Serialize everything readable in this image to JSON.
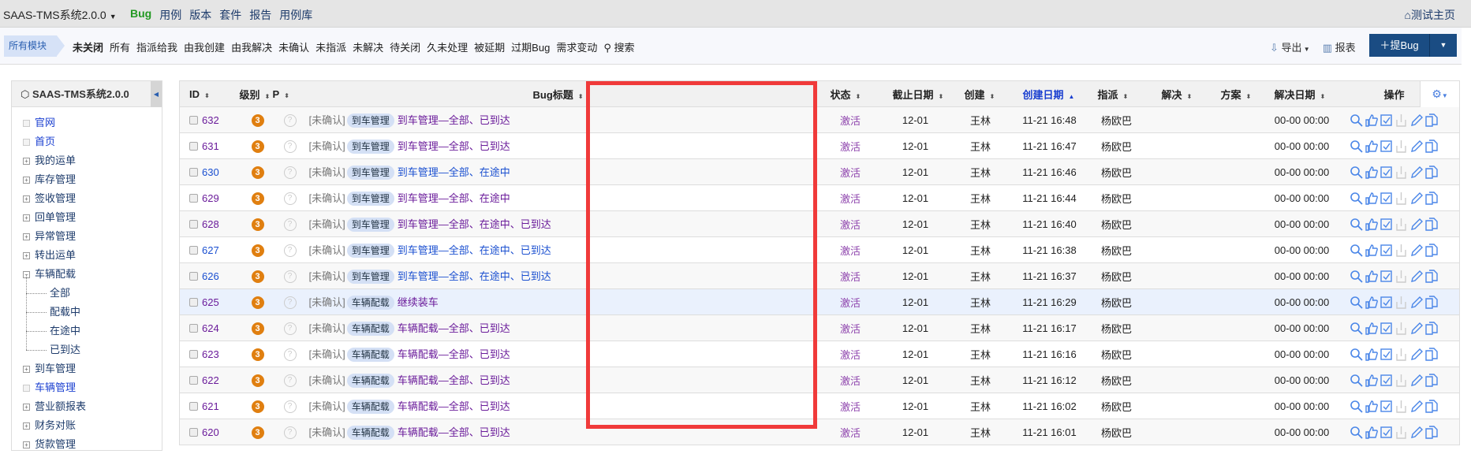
{
  "topbar": {
    "product": "SAAS-TMS系统2.0.0",
    "nav": [
      "Bug",
      "用例",
      "版本",
      "套件",
      "报告",
      "用例库"
    ],
    "home": "测试主页"
  },
  "subnav": {
    "module_label": "所有模块",
    "filters": [
      "未关闭",
      "所有",
      "指派给我",
      "由我创建",
      "由我解决",
      "未确认",
      "未指派",
      "未解决",
      "待关闭",
      "久未处理",
      "被延期",
      "过期Bug",
      "需求变动"
    ],
    "search": "搜索",
    "export": "导出",
    "report": "报表",
    "create_bug": "提Bug"
  },
  "sidebar": {
    "title": "SAAS-TMS系统2.0.0",
    "items": [
      {
        "label": "官网",
        "type": "leaf"
      },
      {
        "label": "首页",
        "type": "leaf"
      },
      {
        "label": "我的运单",
        "type": "plus"
      },
      {
        "label": "库存管理",
        "type": "plus"
      },
      {
        "label": "签收管理",
        "type": "plus"
      },
      {
        "label": "回单管理",
        "type": "plus"
      },
      {
        "label": "异常管理",
        "type": "plus"
      },
      {
        "label": "转出运单",
        "type": "plus"
      },
      {
        "label": "车辆配载",
        "type": "minus"
      },
      {
        "label": "全部",
        "type": "sub"
      },
      {
        "label": "配载中",
        "type": "sub"
      },
      {
        "label": "在途中",
        "type": "sub"
      },
      {
        "label": "已到达",
        "type": "sub"
      },
      {
        "label": "到车管理",
        "type": "plus"
      },
      {
        "label": "车辆管理",
        "type": "leaf"
      },
      {
        "label": "营业额报表",
        "type": "plus"
      },
      {
        "label": "财务对账",
        "type": "plus"
      },
      {
        "label": "货款管理",
        "type": "plus"
      }
    ]
  },
  "table": {
    "headers": {
      "id": "ID",
      "severity": "级别",
      "pri": "P",
      "title": "Bug标题",
      "status": "状态",
      "deadline": "截止日期",
      "creator": "创建",
      "created": "创建日期",
      "assigned": "指派",
      "resolver": "解决",
      "solution": "方案",
      "resolved": "解决日期",
      "actions": "操作"
    },
    "rows": [
      {
        "id": "632",
        "severity": "3",
        "confirm": "[未确认]",
        "module": "到车管理",
        "title": "到车管理—全部、已到达",
        "visited": true,
        "status": "激活",
        "deadline": "12-01",
        "creator": "王林",
        "created": "11-21 16:48",
        "assigned": "杨欧巴",
        "resolved": "00-00 00:00"
      },
      {
        "id": "631",
        "severity": "3",
        "confirm": "[未确认]",
        "module": "到车管理",
        "title": "到车管理—全部、已到达",
        "visited": true,
        "status": "激活",
        "deadline": "12-01",
        "creator": "王林",
        "created": "11-21 16:47",
        "assigned": "杨欧巴",
        "resolved": "00-00 00:00"
      },
      {
        "id": "630",
        "severity": "3",
        "confirm": "[未确认]",
        "module": "到车管理",
        "title": "到车管理—全部、在途中",
        "visited": false,
        "status": "激活",
        "deadline": "12-01",
        "creator": "王林",
        "created": "11-21 16:46",
        "assigned": "杨欧巴",
        "resolved": "00-00 00:00"
      },
      {
        "id": "629",
        "severity": "3",
        "confirm": "[未确认]",
        "module": "到车管理",
        "title": "到车管理—全部、在途中",
        "visited": true,
        "status": "激活",
        "deadline": "12-01",
        "creator": "王林",
        "created": "11-21 16:44",
        "assigned": "杨欧巴",
        "resolved": "00-00 00:00"
      },
      {
        "id": "628",
        "severity": "3",
        "confirm": "[未确认]",
        "module": "到车管理",
        "title": "到车管理—全部、在途中、已到达",
        "visited": true,
        "status": "激活",
        "deadline": "12-01",
        "creator": "王林",
        "created": "11-21 16:40",
        "assigned": "杨欧巴",
        "resolved": "00-00 00:00"
      },
      {
        "id": "627",
        "severity": "3",
        "confirm": "[未确认]",
        "module": "到车管理",
        "title": "到车管理—全部、在途中、已到达",
        "visited": false,
        "status": "激活",
        "deadline": "12-01",
        "creator": "王林",
        "created": "11-21 16:38",
        "assigned": "杨欧巴",
        "resolved": "00-00 00:00"
      },
      {
        "id": "626",
        "severity": "3",
        "confirm": "[未确认]",
        "module": "到车管理",
        "title": "到车管理—全部、在途中、已到达",
        "visited": false,
        "status": "激活",
        "deadline": "12-01",
        "creator": "王林",
        "created": "11-21 16:37",
        "assigned": "杨欧巴",
        "resolved": "00-00 00:00"
      },
      {
        "id": "625",
        "severity": "3",
        "confirm": "[未确认]",
        "module": "车辆配载",
        "title": "继续装车",
        "visited": true,
        "status": "激活",
        "deadline": "12-01",
        "creator": "王林",
        "created": "11-21 16:29",
        "assigned": "杨欧巴",
        "resolved": "00-00 00:00"
      },
      {
        "id": "624",
        "severity": "3",
        "confirm": "[未确认]",
        "module": "车辆配载",
        "title": "车辆配载—全部、已到达",
        "visited": true,
        "status": "激活",
        "deadline": "12-01",
        "creator": "王林",
        "created": "11-21 16:17",
        "assigned": "杨欧巴",
        "resolved": "00-00 00:00"
      },
      {
        "id": "623",
        "severity": "3",
        "confirm": "[未确认]",
        "module": "车辆配载",
        "title": "车辆配载—全部、已到达",
        "visited": true,
        "status": "激活",
        "deadline": "12-01",
        "creator": "王林",
        "created": "11-21 16:16",
        "assigned": "杨欧巴",
        "resolved": "00-00 00:00"
      },
      {
        "id": "622",
        "severity": "3",
        "confirm": "[未确认]",
        "module": "车辆配载",
        "title": "车辆配载—全部、已到达",
        "visited": true,
        "status": "激活",
        "deadline": "12-01",
        "creator": "王林",
        "created": "11-21 16:12",
        "assigned": "杨欧巴",
        "resolved": "00-00 00:00"
      },
      {
        "id": "621",
        "severity": "3",
        "confirm": "[未确认]",
        "module": "车辆配载",
        "title": "车辆配载—全部、已到达",
        "visited": true,
        "status": "激活",
        "deadline": "12-01",
        "creator": "王林",
        "created": "11-21 16:02",
        "assigned": "杨欧巴",
        "resolved": "00-00 00:00"
      },
      {
        "id": "620",
        "severity": "3",
        "confirm": "[未确认]",
        "module": "车辆配载",
        "title": "车辆配载—全部、已到达",
        "visited": true,
        "status": "激活",
        "deadline": "12-01",
        "creator": "王林",
        "created": "11-21 16:01",
        "assigned": "杨欧巴",
        "resolved": "00-00 00:00"
      }
    ]
  },
  "colors": {
    "accent": "#1a4c83",
    "highlight": "#f03a3a",
    "severity": "#e07f10"
  }
}
